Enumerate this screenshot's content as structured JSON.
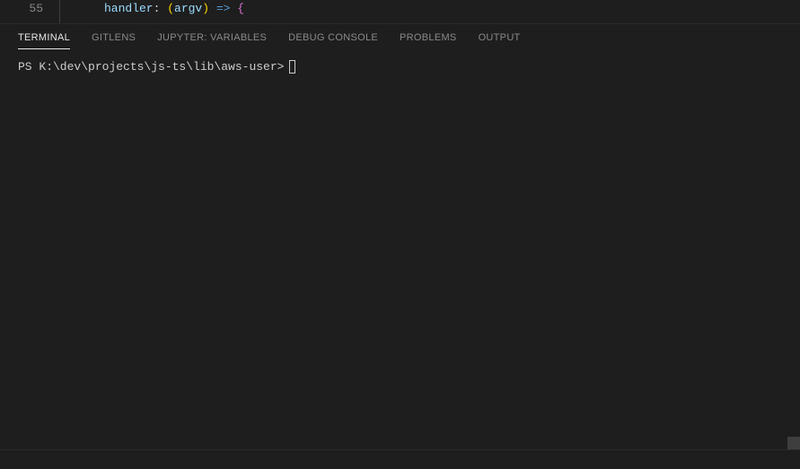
{
  "editor": {
    "line_number": "55",
    "code_prop": "handler",
    "code_colon": ": ",
    "code_lparen": "(",
    "code_param": "argv",
    "code_rparen": ")",
    "code_space": " ",
    "code_arrow": "=>",
    "code_space2": " ",
    "code_brace": "{"
  },
  "panel": {
    "tabs": {
      "terminal": "TERMINAL",
      "gitlens": "GITLENS",
      "jupyter": "JUPYTER: VARIABLES",
      "debug": "DEBUG CONSOLE",
      "problems": "PROBLEMS",
      "output": "OUTPUT"
    }
  },
  "terminal": {
    "prompt": "PS K:\\dev\\projects\\js-ts\\lib\\aws-user>"
  }
}
